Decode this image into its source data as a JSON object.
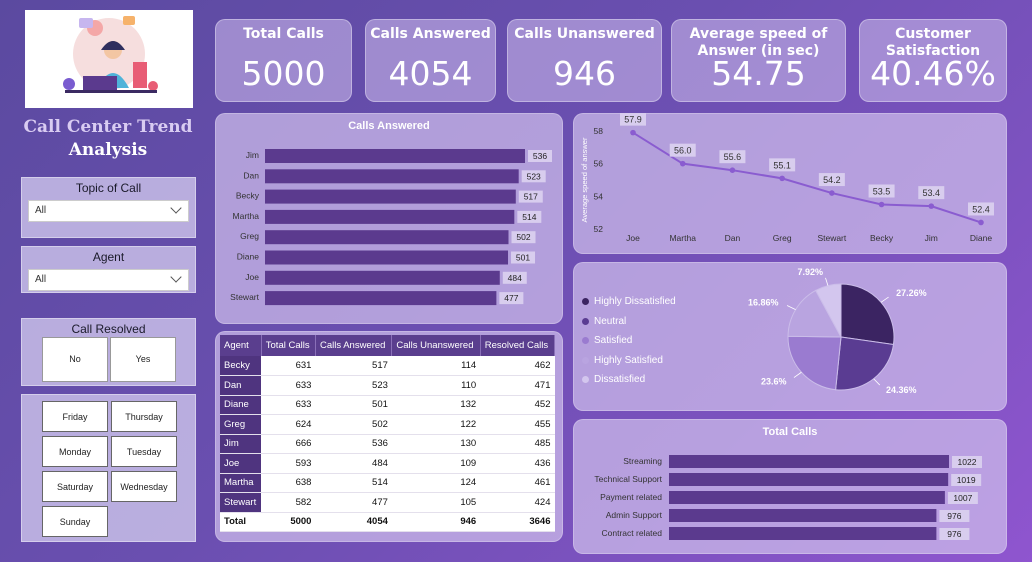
{
  "app": {
    "title_line1": "Call Center Trend",
    "title_line2": "Analysis"
  },
  "kpis": {
    "total_calls": {
      "title": "Total Calls",
      "value": "5000"
    },
    "calls_answered": {
      "title": "Calls Answered",
      "value": "4054"
    },
    "calls_unanswered": {
      "title": "Calls Unanswered",
      "value": "946"
    },
    "avg_speed": {
      "title_line1": "Average speed of",
      "title_line2": "Answer (in sec)",
      "value": "54.75"
    },
    "satisfaction": {
      "title_line1": "Customer",
      "title_line2": "Satisfaction",
      "value": "40.46%"
    }
  },
  "filters": {
    "topic": {
      "title": "Topic of Call",
      "value": "All"
    },
    "agent": {
      "title": "Agent",
      "value": "All"
    },
    "resolved": {
      "title": "Call Resolved",
      "options": [
        "No",
        "Yes"
      ]
    },
    "days": [
      "Friday",
      "Thursday",
      "Monday",
      "Tuesday",
      "Saturday",
      "Wednesday",
      "Sunday"
    ]
  },
  "colors": {
    "bar": "#5b3a8e",
    "line": "#8a5cd0",
    "pie": [
      "#3b2462",
      "#5a3c92",
      "#9a7bd0",
      "#b9a4e0",
      "#d3c6ee"
    ]
  },
  "chart_data": [
    {
      "type": "bar",
      "title": "Calls Answered",
      "categories": [
        "Jim",
        "Dan",
        "Becky",
        "Martha",
        "Greg",
        "Diane",
        "Joe",
        "Stewart"
      ],
      "values": [
        536,
        523,
        517,
        514,
        502,
        501,
        484,
        477
      ]
    },
    {
      "type": "line",
      "ylabel": "Average speed of answer",
      "categories": [
        "Joe",
        "Martha",
        "Dan",
        "Greg",
        "Stewart",
        "Becky",
        "Jim",
        "Diane"
      ],
      "values": [
        57.9,
        56.0,
        55.6,
        55.1,
        54.2,
        53.5,
        53.4,
        52.4
      ],
      "ylim": [
        52,
        58
      ],
      "yticks": [
        "52",
        "54",
        "56",
        "58"
      ]
    },
    {
      "type": "pie",
      "categories": [
        "Highly Dissatisfied",
        "Neutral",
        "Satisfied",
        "Highly Satisfied",
        "Dissatisfied"
      ],
      "values": [
        27.26,
        24.36,
        23.6,
        16.86,
        7.92
      ],
      "labels": [
        "27.26%",
        "24.36%",
        "23.6%",
        "16.86%",
        "7.92%"
      ]
    },
    {
      "type": "bar",
      "title": "Total Calls",
      "categories": [
        "Streaming",
        "Technical Support",
        "Payment related",
        "Admin Support",
        "Contract related"
      ],
      "values": [
        1022,
        1019,
        1007,
        976,
        976
      ]
    },
    {
      "type": "table",
      "columns": [
        "Agent",
        "Total Calls",
        "Calls Answered",
        "Calls Unanswered",
        "Resolved Calls"
      ],
      "rows": [
        [
          "Becky",
          "631",
          "517",
          "114",
          "462"
        ],
        [
          "Dan",
          "633",
          "523",
          "110",
          "471"
        ],
        [
          "Diane",
          "633",
          "501",
          "132",
          "452"
        ],
        [
          "Greg",
          "624",
          "502",
          "122",
          "455"
        ],
        [
          "Jim",
          "666",
          "536",
          "130",
          "485"
        ],
        [
          "Joe",
          "593",
          "484",
          "109",
          "436"
        ],
        [
          "Martha",
          "638",
          "514",
          "124",
          "461"
        ],
        [
          "Stewart",
          "582",
          "477",
          "105",
          "424"
        ]
      ],
      "total": [
        "Total",
        "5000",
        "4054",
        "946",
        "3646"
      ]
    }
  ]
}
